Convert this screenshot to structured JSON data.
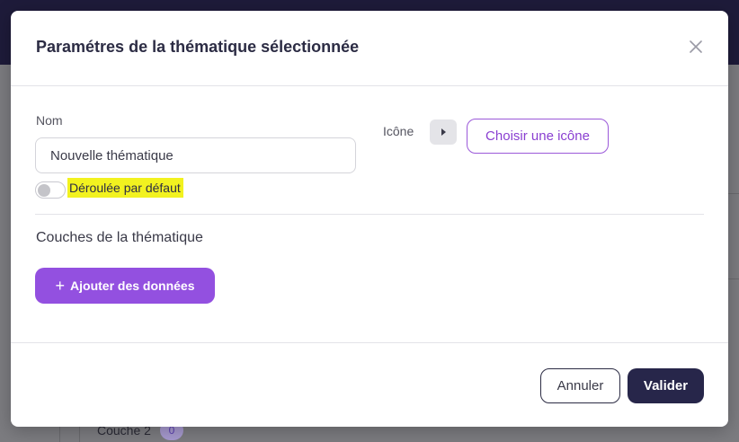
{
  "background": {
    "row_label": "Couche 2",
    "row_badge": "0"
  },
  "modal": {
    "title": "Paramétres de la thématique sélectionnée",
    "close_icon": "close-icon"
  },
  "form": {
    "name_label": "Nom",
    "name_value": "Nouvelle thématique",
    "name_placeholder": "",
    "toggle_label": "Déroulée par défaut",
    "toggle_on": false,
    "icon_label": "Icône",
    "icon_preview": "caret-right-icon",
    "choose_icon_label": "Choisir une icône"
  },
  "layers": {
    "title": "Couches de la thématique",
    "add_button_label": "Ajouter des données",
    "add_button_icon": "plus-icon"
  },
  "footer": {
    "cancel_label": "Annuler",
    "validate_label": "Valider"
  },
  "colors": {
    "accent_purple": "#9350e0",
    "outline_purple": "#9b59d9",
    "dark_navy": "#27264a",
    "highlight_yellow": "#f2f21f"
  }
}
